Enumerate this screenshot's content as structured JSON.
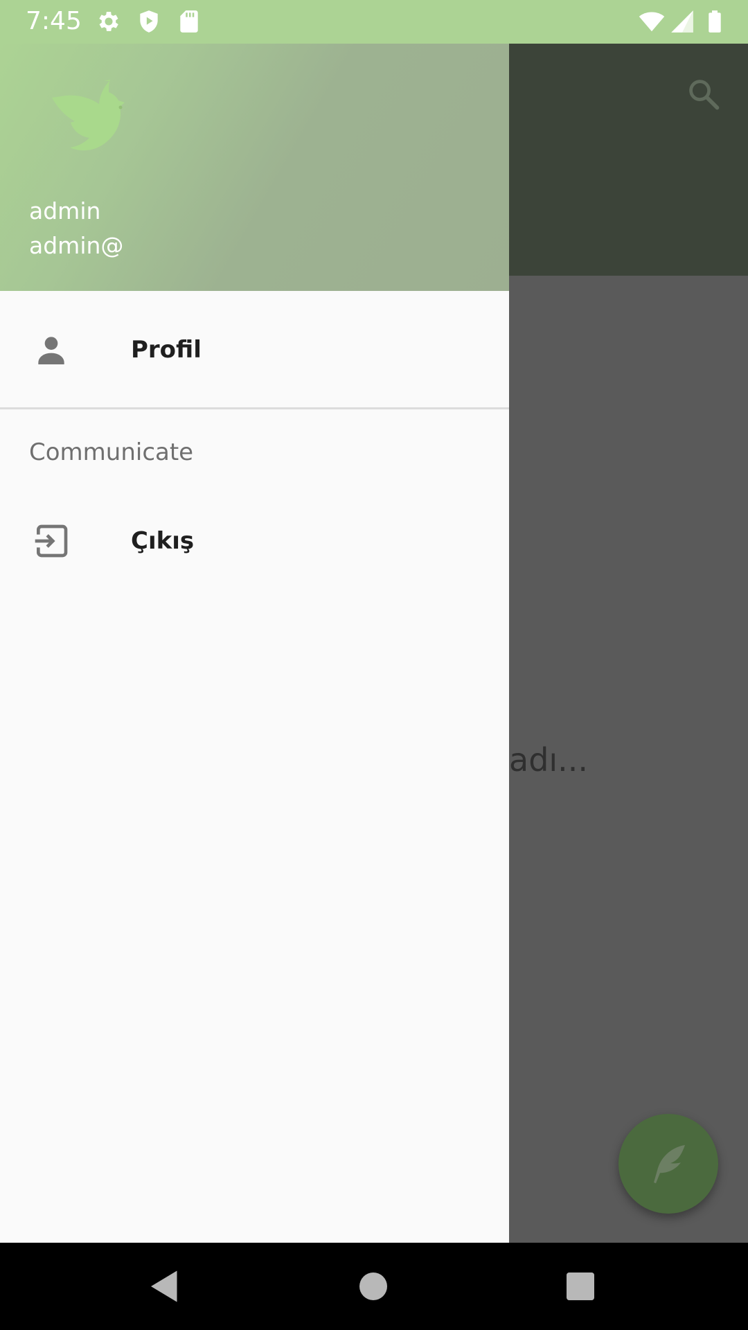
{
  "status_bar": {
    "time": "7:45",
    "background_color": "#acd394",
    "icons": [
      "gear-icon",
      "shield-play-icon",
      "sd-card-icon",
      "wifi-icon",
      "signal-icon",
      "battery-icon"
    ]
  },
  "drawer": {
    "header": {
      "logo_icon": "dove-icon",
      "username": "admin",
      "email": "admin@"
    },
    "items": [
      {
        "label": "Profil",
        "icon": "person-icon"
      }
    ],
    "section": {
      "title": "Communicate",
      "items": [
        {
          "label": "Çıkış",
          "icon": "logout-icon"
        }
      ]
    }
  },
  "background_app": {
    "toolbar_icon": "search-icon",
    "content_text": "adı...",
    "fab_icon": "feather-icon",
    "accent_color": "#4b6a3e"
  },
  "nav_bar": {
    "buttons": [
      "back-button",
      "home-button",
      "recents-button"
    ]
  }
}
